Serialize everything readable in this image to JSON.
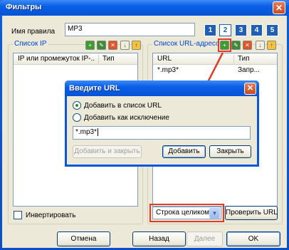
{
  "window": {
    "title": "Фильтры",
    "close_glyph": "✕"
  },
  "rule": {
    "label": "Имя правила",
    "value": "MP3"
  },
  "steps": [
    "1",
    "2",
    "3",
    "4",
    "5"
  ],
  "ip_list": {
    "title": "Список IP",
    "columns": [
      "IP или промежуток IP-...",
      "Тип"
    ],
    "invert_label": "Инвертировать"
  },
  "url_list": {
    "title": "Список URL-адресов",
    "columns": [
      "URL",
      "Тип"
    ],
    "rows": [
      {
        "url": "*.mp3*",
        "type": "Запр..."
      }
    ],
    "match_mode": "Строка целиком",
    "check_button": "Проверить URL"
  },
  "toolbar_icons": [
    "add-icon",
    "edit-icon",
    "delete-icon",
    "import-icon",
    "export-icon"
  ],
  "dialog": {
    "title": "Введите URL",
    "close_glyph": "✕",
    "radio_add": "Добавить в список URL",
    "radio_exception": "Добавить как исключение",
    "input_value": "*.mp3*",
    "btn_add_close": "Добавить и закрыть",
    "btn_add": "Добавить",
    "btn_close": "Закрыть"
  },
  "footer": {
    "cancel": "Отмена",
    "back": "Назад",
    "next": "Далее",
    "ok": "OK"
  },
  "colors": {
    "title_bar": "#0a5fe6",
    "face": "#ece9d8",
    "group_title": "#0046d5",
    "highlight": "#e23a25",
    "step": "#1f5fb6"
  }
}
